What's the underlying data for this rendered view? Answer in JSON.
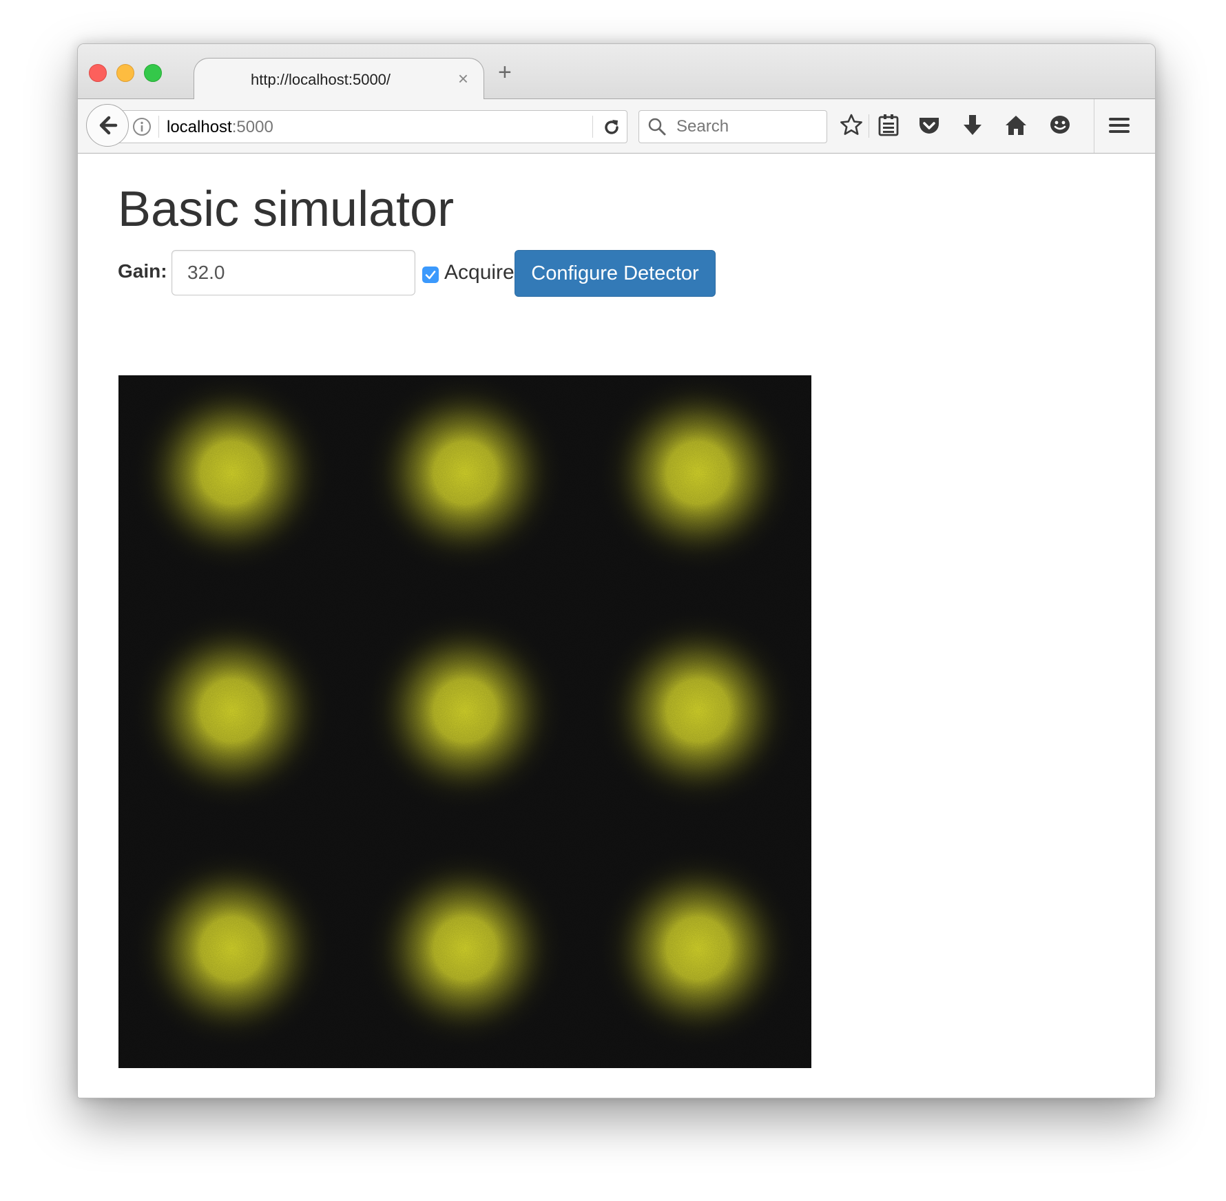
{
  "browser": {
    "tab_title": "http://localhost:5000/",
    "tab_close": "×",
    "new_tab": "+",
    "url_host": "localhost",
    "url_port": ":5000",
    "search_placeholder": "Search"
  },
  "page": {
    "title": "Basic simulator",
    "gain_label": "Gain:",
    "gain_value": "32.0",
    "acquire_label": "Acquire",
    "acquire_checked": true,
    "configure_button": "Configure Detector"
  },
  "image": {
    "grid_rows": 3,
    "grid_cols": 3,
    "spot_color": "#d4d42a",
    "background_color": "#111111"
  }
}
